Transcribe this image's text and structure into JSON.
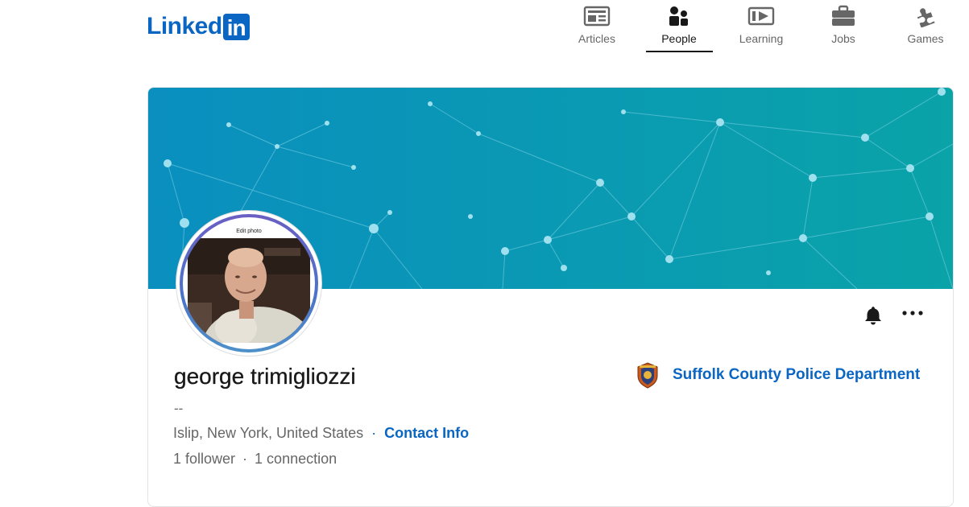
{
  "header": {
    "logo_text": "Linked",
    "logo_box": "in",
    "nav": [
      {
        "label": "Articles",
        "icon": "articles-icon",
        "active": false
      },
      {
        "label": "People",
        "icon": "people-icon",
        "active": true
      },
      {
        "label": "Learning",
        "icon": "learning-icon",
        "active": false
      },
      {
        "label": "Jobs",
        "icon": "briefcase-icon",
        "active": false
      },
      {
        "label": "Games",
        "icon": "puzzle-icon",
        "active": false
      }
    ]
  },
  "profile": {
    "edit_photo": "Edit photo",
    "name": "george trimigliozzi",
    "headline": "--",
    "location": "Islip, New York, United States",
    "separator": "·",
    "contact_info": "Contact Info",
    "followers": "1 follower",
    "connections": "1 connection",
    "company": "Suffolk County Police Department"
  },
  "colors": {
    "brand": "#0a66c2",
    "cover_start": "#0a8fbf",
    "cover_end": "#0aa3a8"
  }
}
